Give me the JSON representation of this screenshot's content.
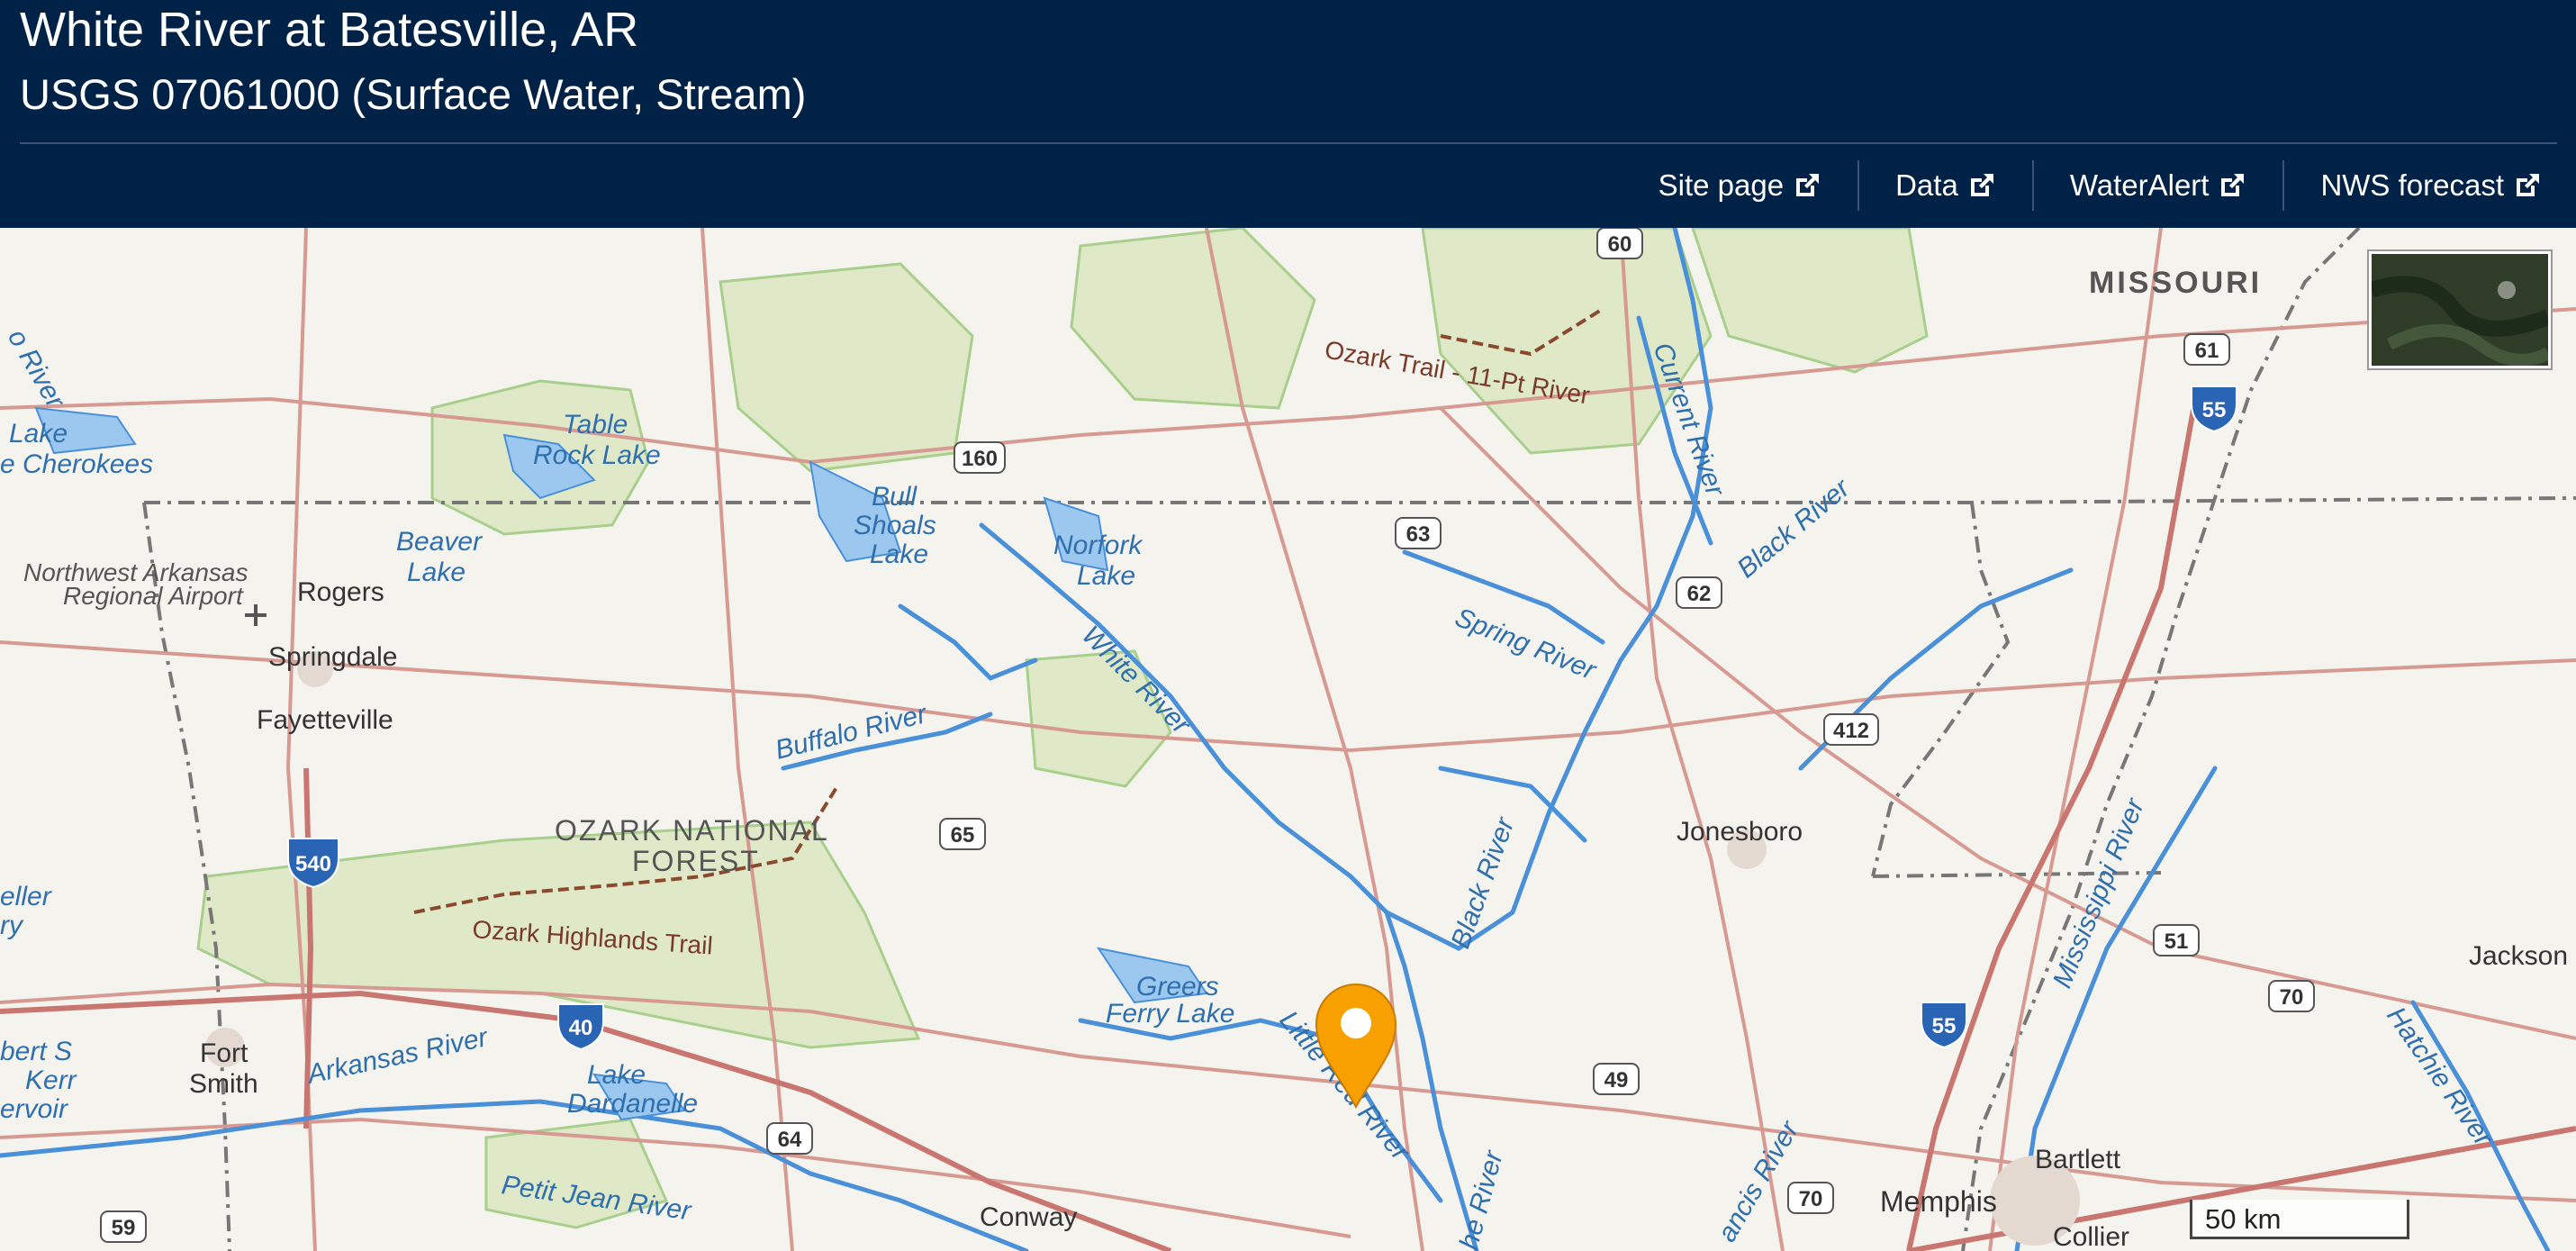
{
  "header": {
    "title": "White River at Batesville, AR",
    "subtitle": "USGS 07061000 (Surface Water, Stream)"
  },
  "nav": {
    "links": [
      {
        "label": "Site page",
        "icon": "external-link-icon"
      },
      {
        "label": "Data",
        "icon": "external-link-icon"
      },
      {
        "label": "WaterAlert",
        "icon": "external-link-icon"
      },
      {
        "label": "NWS forecast",
        "icon": "external-link-icon"
      }
    ]
  },
  "map": {
    "marker_color": "#F7A000",
    "scale_label": "50 km",
    "places": [
      "MISSOURI",
      "Rogers",
      "Springdale",
      "Fayetteville",
      "Fort",
      "Smith",
      "Conway",
      "Jonesboro",
      "Memphis",
      "Bartlett",
      "Collier",
      "Jackson"
    ],
    "water_labels": [
      "Table",
      "Rock Lake",
      "Bull",
      "Shoals",
      "Lake",
      "Norfork",
      "Lake",
      "Beaver",
      "Lake",
      "Lake",
      "e Cherokees",
      "White River",
      "Buffalo River",
      "Greers",
      "Ferry Lake",
      "Little Red River",
      "Black River",
      "Spring River",
      "Black River",
      "Current River",
      "Arkansas River",
      "Lake",
      "Dardanelle",
      "Petit Jean River",
      "Mississippi River",
      "Hatchie River",
      "ancis River",
      "he River",
      "o River",
      "eller",
      "ry",
      "bert S",
      "Kerr",
      "ervoir"
    ],
    "other_labels": [
      "Northwest Arkansas",
      "Regional Airport",
      "OZARK NATIONAL",
      "FOREST",
      "Ozark Highlands Trail",
      "Ozark Trail - 11-Pt River"
    ],
    "shields": [
      "60",
      "160",
      "61",
      "55",
      "63",
      "62",
      "412",
      "65",
      "540",
      "51",
      "70",
      "40",
      "49",
      "55",
      "64",
      "70",
      "59"
    ]
  }
}
